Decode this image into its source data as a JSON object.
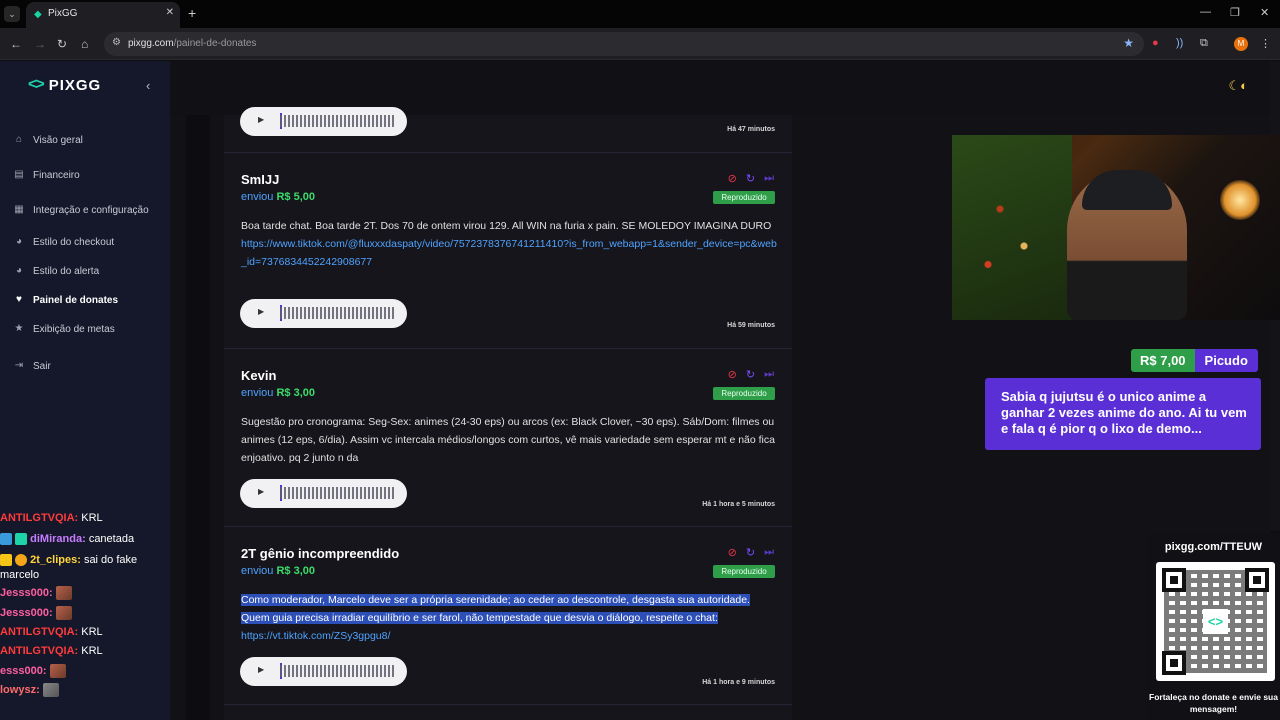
{
  "browser": {
    "tab_title": "PixGG",
    "url_domain": "pixgg.com",
    "url_path": "/painel-de-donates",
    "profile_initial": "M"
  },
  "sidebar": {
    "logo_text": "PIXGG",
    "items": [
      {
        "label": "Visão geral",
        "icon": "home-icon"
      },
      {
        "label": "Financeiro",
        "icon": "wallet-icon"
      },
      {
        "label": "Integração e configuração",
        "icon": "settings-icon"
      },
      {
        "label": "Estilo do checkout",
        "icon": "palette-icon"
      },
      {
        "label": "Estilo do alerta",
        "icon": "palette-icon"
      },
      {
        "label": "Painel de donates",
        "icon": "hand-heart-icon",
        "active": true
      },
      {
        "label": "Exibição de metas",
        "icon": "star-icon"
      },
      {
        "label": "Sair",
        "icon": "logout-icon"
      }
    ]
  },
  "feed": {
    "sent_label": "enviou",
    "played_badge": "Reproduzido",
    "top_time": "Há 47 minutos",
    "donations": [
      {
        "name": "SmIJJ",
        "amount": "R$ 5,00",
        "message": "Boa tarde chat. Boa tarde 2T. Dos 70 de ontem virou 129. All WIN na furia x pain. SE MOLEDOY IMAGINA DURO",
        "link": "https://www.tiktok.com/@fluxxxdaspaty/video/7572378376741211410?is_from_webapp=1&sender_device=pc&web_id=7376834452242908677",
        "time": "Há 59 minutos"
      },
      {
        "name": "Kevin",
        "amount": "R$ 3,00",
        "message": "Sugestão pro cronograma: Seg-Sex: animes (24-30 eps) ou arcos (ex: Black Clover, ~30 eps). Sáb/Dom: filmes ou animes (12 eps, 6/dia). Assim vc intercala médios/longos com curtos, vê mais variedade sem esperar mt e não fica enjoativo. pq 2 junto n da",
        "time": "Há 1 hora e 5 minutos"
      },
      {
        "name": "2T gênio incompreendido",
        "amount": "R$ 3,00",
        "message": "Como moderador, Marcelo deve ser a própria serenidade; ao ceder ao descontrole, desgasta sua autoridade. Quem guia precisa irradiar equilíbrio e ser farol, não tempestade que desvia o diálogo, respeite o chat:",
        "link": "https://vt.tiktok.com/ZSy3gpgu8/",
        "time": "Há 1 hora e 9 minutos"
      }
    ]
  },
  "overlay": {
    "tts_amount": "R$ 7,00",
    "tts_name": "Picudo",
    "tts_message": "Sabia q jujutsu é o unico anime a ganhar 2 vezes anime do ano. Ai tu vem e fala q é pior q o lixo de demo...",
    "qr_url": "pixgg.com/TTEUW",
    "qr_caption": "Fortaleça no donate e envie sua mensagem!"
  },
  "chat": [
    {
      "user": "ANTILGTVQIA:",
      "text": "KRL",
      "color": "#ff3b3b"
    },
    {
      "user": "diMiranda:",
      "text": "canetada",
      "color": "#c77dff"
    },
    {
      "user": "2t_clipes:",
      "text": "sai do fake marcelo",
      "color": "#ffd43b"
    },
    {
      "user": "Jesss000:",
      "text": "",
      "color": "#ff5fa2"
    },
    {
      "user": "Jesss000:",
      "text": "",
      "color": "#ff5fa2"
    },
    {
      "user": "ANTILGTVQIA:",
      "text": "KRL",
      "color": "#ff3b3b"
    },
    {
      "user": "ANTILGTVQIA:",
      "text": "KRL",
      "color": "#ff3b3b"
    },
    {
      "user": "esss000:",
      "text": "",
      "color": "#ff5fa2"
    },
    {
      "user": "lowysz:",
      "text": "",
      "color": "#ff6b6b"
    }
  ]
}
